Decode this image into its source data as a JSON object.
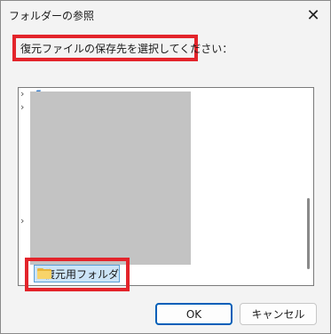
{
  "window": {
    "title": "フォルダーの参照",
    "close_glyph": "✕"
  },
  "instruction": "復元ファイルの保存先を選択してください：",
  "tree": {
    "expander_glyph": "›",
    "selected_folder": "復元用フォルダ"
  },
  "buttons": {
    "ok": "OK",
    "cancel": "キャンセル"
  },
  "colors": {
    "annotation_red": "#e3242b",
    "selection_blue": "#cce4f7",
    "folder_yellow": "#f8d46a"
  }
}
